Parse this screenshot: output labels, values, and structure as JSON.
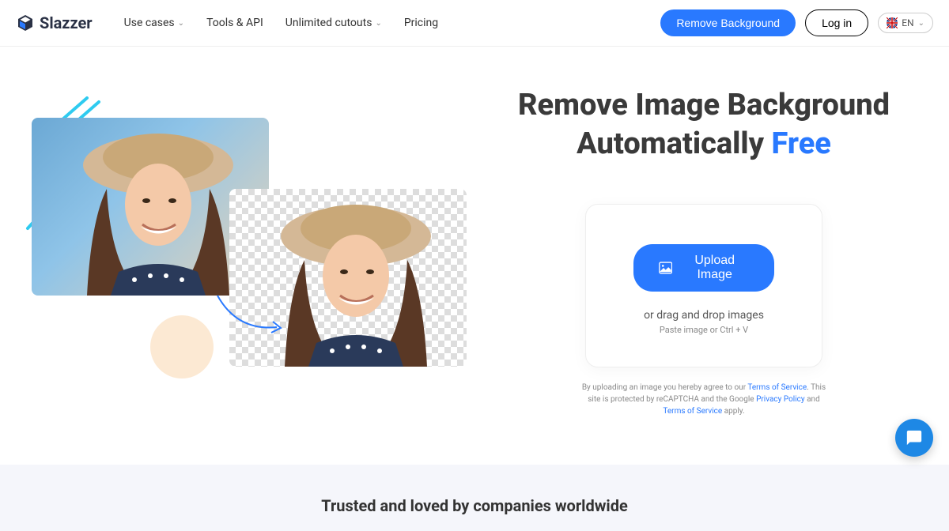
{
  "brand": "Slazzer",
  "nav": {
    "use_cases": "Use cases",
    "tools": "Tools & API",
    "unlimited": "Unlimited cutouts",
    "pricing": "Pricing"
  },
  "header": {
    "remove_bg": "Remove Background",
    "login": "Log in",
    "lang": "EN"
  },
  "hero": {
    "headline_1": "Remove Image Background",
    "headline_2": "Automatically",
    "headline_accent": "Free"
  },
  "upload": {
    "button": "Upload Image",
    "drag": "or drag and drop images",
    "paste": "Paste image or Ctrl + V"
  },
  "legal": {
    "prefix": "By uploading an image you hereby agree to our ",
    "tos": "Terms of Service",
    "mid": ". This site is protected by reCAPTCHA and the Google ",
    "privacy": "Privacy Policy",
    "and": " and ",
    "tos2": "Terms of Service",
    "suffix": " apply."
  },
  "trusted": {
    "title": "Trusted and loved by companies worldwide"
  }
}
